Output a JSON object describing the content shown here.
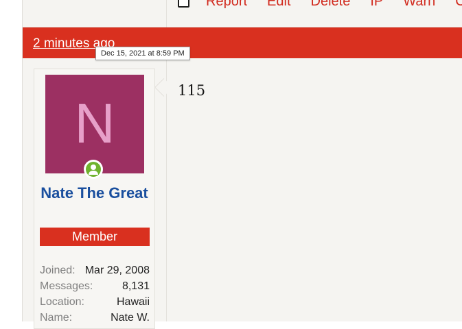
{
  "previous_post": {
    "actions": [
      "Report",
      "Edit",
      "Delete",
      "IP",
      "Warn",
      "C"
    ]
  },
  "post": {
    "time_link": "2 minutes ago",
    "tooltip": "Dec 15, 2021 at 8:59 PM",
    "user": {
      "avatar_letter": "N",
      "avatar_color": "#9c3062",
      "name": "Nate The Great",
      "role": "Member",
      "stats": [
        {
          "label": "Joined:",
          "value": "Mar 29, 2008"
        },
        {
          "label": "Messages:",
          "value": "8,131"
        },
        {
          "label": "Location:",
          "value": "Hawaii"
        },
        {
          "label": "Name:",
          "value": "Nate W."
        }
      ]
    },
    "content": "115"
  },
  "colors": {
    "accent": "#d9301f",
    "username": "#1a4f9e",
    "online": "#6fb32e"
  }
}
